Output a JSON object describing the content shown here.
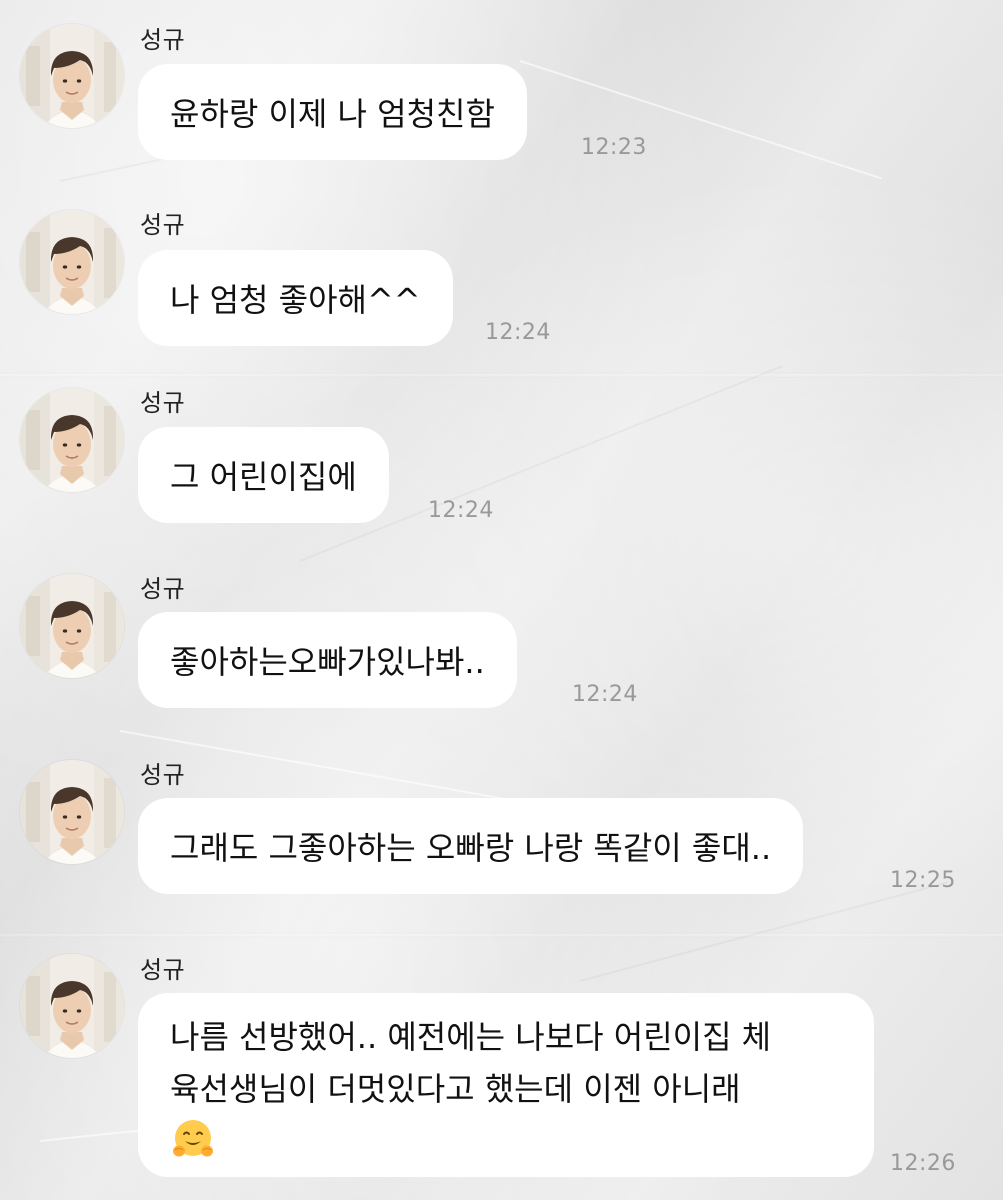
{
  "chat": {
    "messages": [
      {
        "sender": "성규",
        "lines": [
          "윤하랑 이제 나 엄청친함"
        ],
        "time": "12:23"
      },
      {
        "sender": "성규",
        "lines": [
          "나 엄청 좋아해^^"
        ],
        "time": "12:24"
      },
      {
        "sender": "성규",
        "lines": [
          "그 어린이집에"
        ],
        "time": "12:24"
      },
      {
        "sender": "성규",
        "lines": [
          "좋아하는오빠가있나봐.."
        ],
        "time": "12:24"
      },
      {
        "sender": "성규",
        "lines": [
          "그래도 그좋아하는 오빠랑 나랑 똑같이 좋대.."
        ],
        "time": "12:25"
      },
      {
        "sender": "성규",
        "lines": [
          "나름 선방했어.. 예전에는 나보다 어린이집 체",
          "육선생님이 더멋있다고 했는데 이젠 아니래"
        ],
        "emoji": "hugging-face-emoji",
        "time": "12:26"
      }
    ]
  }
}
